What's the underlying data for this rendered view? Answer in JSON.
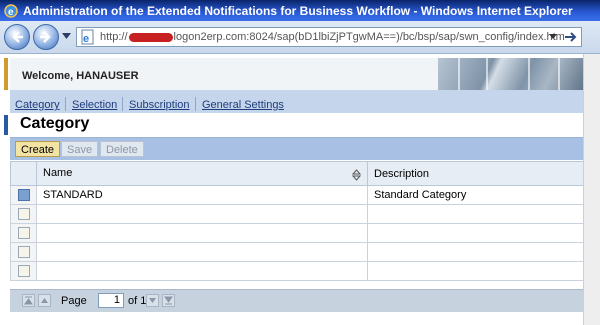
{
  "window": {
    "title": "Administration of the Extended Notifications for Business Workflow - Windows Internet Explorer"
  },
  "address": {
    "url_prefix": "http://",
    "url_suffix": "logon2erp.com:8024/sap(bD1lbiZjPTgwMA==)/bc/bsp/sap/swn_config/index.htm"
  },
  "header": {
    "welcome": "Welcome, HANAUSER"
  },
  "tabs": [
    {
      "label": "Category"
    },
    {
      "label": "Selection"
    },
    {
      "label": "Subscription"
    },
    {
      "label": "General Settings"
    }
  ],
  "area": {
    "title": "Category"
  },
  "toolbar": {
    "create_label": "Create",
    "save_label": "Save",
    "delete_label": "Delete"
  },
  "table": {
    "columns": [
      "Name",
      "Description"
    ],
    "rows": [
      {
        "name": "STANDARD",
        "description": "Standard Category",
        "selected": true
      },
      {
        "name": "",
        "description": "",
        "selected": false
      },
      {
        "name": "",
        "description": "",
        "selected": false
      },
      {
        "name": "",
        "description": "",
        "selected": false
      },
      {
        "name": "",
        "description": "",
        "selected": false
      }
    ]
  },
  "pager": {
    "page_label": "Page",
    "page_value": "1",
    "of_label": "of 1"
  },
  "colors": {
    "titlebar": "#0a246a",
    "tabs_bg": "#c4d5ec",
    "toolbar_bg": "#a7c0e3",
    "create_button": "#f3e4a4"
  },
  "icons": [
    "ie-logo-icon",
    "back-icon",
    "forward-icon",
    "page-icon",
    "go-icon",
    "sort-icon",
    "first-page-icon",
    "previous-page-icon",
    "next-page-icon",
    "last-page-icon"
  ]
}
